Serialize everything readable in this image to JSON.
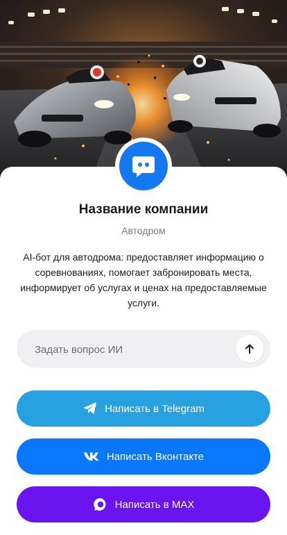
{
  "company": {
    "name": "Название компании",
    "type": "Автодром",
    "description": "AI-бот для автодрома: предоставляет информацию о соревнованиях, помогает забронировать места, информирует об услугах и ценах на предоставляемые услуги."
  },
  "ask": {
    "placeholder": "Задать вопрос ИИ",
    "send_icon": "arrow-up-icon"
  },
  "buttons": {
    "telegram": {
      "label": "Написать в Telegram",
      "icon": "telegram-icon",
      "color": "#27a1e0"
    },
    "vk": {
      "label": "Написать Вконтакте",
      "icon": "vk-icon",
      "color": "#0a77ff"
    },
    "max": {
      "label": "Написать в MAX",
      "icon": "max-icon",
      "color": "#6a14ef"
    }
  },
  "colors": {
    "avatar": "#1479f0",
    "input_bg": "#f0f0f2"
  }
}
